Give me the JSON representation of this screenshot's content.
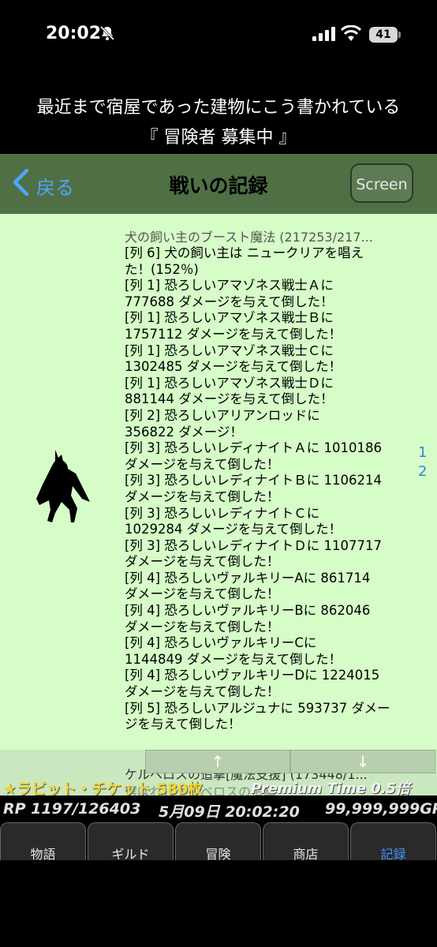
{
  "status_bar": {
    "time": "20:02",
    "battery": "41",
    "icons": [
      "bell-slash-icon",
      "signal-icon",
      "wifi-icon",
      "battery-icon"
    ]
  },
  "story": {
    "line1": "最近まで宿屋であった建物にこう書かれている",
    "line2": "『 冒険者 募集中 』"
  },
  "navbar": {
    "back_label": "戻る",
    "title": "戦いの記録",
    "screen_button": "Screen"
  },
  "log": {
    "header": "犬の飼い主のブースト魔法 (217253/217...",
    "lines": [
      "[列 6] 犬の飼い主は ニュークリアを唱え",
      "た！(152％)",
      "[列 1] 恐ろしいアマゾネス戦士Ａに",
      "777688 ダメージを与えて倒した！",
      "[列 1] 恐ろしいアマゾネス戦士Ｂに",
      "1757112 ダメージを与えて倒した！",
      "[列 1] 恐ろしいアマゾネス戦士Ｃに",
      "1302485 ダメージを与えて倒した！",
      "[列 1] 恐ろしいアマゾネス戦士Ｄに",
      "881144 ダメージを与えて倒した！",
      "[列 2] 恐ろしいアリアンロッドに",
      "356822 ダメージ！",
      "[列 3] 恐ろしいレディナイトＡに 1010186",
      "ダメージを与えて倒した！",
      "[列 3] 恐ろしいレディナイトＢに 1106214",
      "ダメージを与えて倒した！",
      "[列 3] 恐ろしいレディナイトＣに",
      "1029284 ダメージを与えて倒した！",
      "[列 3] 恐ろしいレディナイトＤに 1107717",
      "ダメージを与えて倒した！",
      "[列 4] 恐ろしいヴァルキリーAに 861714",
      "ダメージを与えて倒した！",
      "[列 4] 恐ろしいヴァルキリーBに 862046",
      "ダメージを与えて倒した！",
      "[列 4] 恐ろしいヴァルキリーCに",
      "1144849 ダメージを与えて倒した！",
      "[列 4] 恐ろしいヴァルキリーDに 1224015",
      "ダメージを与えて倒した！",
      "[列 5] 恐ろしいアルジュナに 593737 ダメー",
      "ジを与えて倒した！"
    ],
    "pages": [
      "1",
      "2"
    ],
    "next_header": "ケルベロスの追撃[魔法支援] (173448/1...",
    "next_line": "選ばれしケルベロスの追撃"
  },
  "scroll": {
    "up": "↑",
    "down": "↓"
  },
  "overlay": {
    "ticket": "★ラビット・チケット 580枚",
    "premium": "Premium Time 0.5倍"
  },
  "info": {
    "rp": "RP 1197/126403",
    "date": "5月09日 20:02:20",
    "gp": "99,999,999GP"
  },
  "tabs": [
    {
      "label": "物語",
      "active": false
    },
    {
      "label": "ギルド",
      "active": false
    },
    {
      "label": "冒険",
      "active": false
    },
    {
      "label": "商店",
      "active": false
    },
    {
      "label": "記録",
      "active": true
    }
  ],
  "colors": {
    "nav_bg": "#4f6f45",
    "content_bg": "#d6fcc8",
    "accent": "#3f96ff",
    "ticket": "#f0d430"
  }
}
